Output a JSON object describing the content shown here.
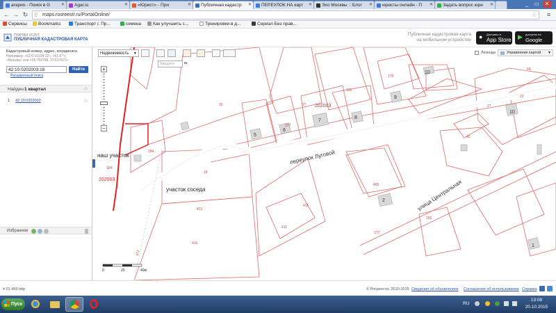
{
  "browser": {
    "tabs": [
      {
        "label": "агарио - Поиск в G",
        "fav": "#3b7be0"
      },
      {
        "label": "Agar.io",
        "fav": "#a43ad9"
      },
      {
        "label": "«Юрист» - При",
        "fav": "#e05a2a"
      },
      {
        "label": "Публичная кадастр",
        "fav": "#3a6fc9",
        "active": true
      },
      {
        "label": "ПЕРЕУЛОК НА карт",
        "fav": "#3b7be0"
      },
      {
        "label": "Эхо Москвы :: Блог",
        "fav": "#333333"
      },
      {
        "label": "юристы онлайн - П",
        "fav": "#3b7be0"
      },
      {
        "label": "Задать вопрос юри",
        "fav": "#2bb24c"
      }
    ],
    "url": "maps.rosreestr.ru/PortalOnline/",
    "bookmarks": [
      {
        "label": "Сервисы",
        "color": "#e04a2f"
      },
      {
        "label": "Bookmarks",
        "color": "#f4c430"
      },
      {
        "label": "Транспорт г. Пр...",
        "color": "#2a7be4"
      },
      {
        "label": "семена",
        "color": "#2bb24c"
      },
      {
        "label": "Как улучшить с...",
        "color": "#999999"
      },
      {
        "label": "Тренировки в д...",
        "color": "#ffffff"
      },
      {
        "label": "Сериал Без прав...",
        "color": "#3a3a3a"
      }
    ]
  },
  "portal": {
    "logo_line1": "ПОРТАЛ УСЛУГ",
    "logo_line2": "ПУБЛИЧНАЯ КАДАСТРОВАЯ КАРТА",
    "mobile_line1": "Публичная кадастровая карта",
    "mobile_line2": "на мобильном устройстве",
    "appstore_small": "Доступно в",
    "appstore_big": "App Store",
    "gplay_small": "доступно на",
    "gplay_big": "Google play"
  },
  "search": {
    "hint_title": "Кадастровый номер, адрес, координата",
    "hint_example1": "Например: «61:6:10104:12», «61:6:*»,",
    "hint_example2": "«Москва» или «55.755768, 37.617671»",
    "value": "42:10:0202003:18",
    "button": "Найти",
    "advanced": "Расширенный поиск",
    "found_prefix": "Найден",
    "found_bold": "1 квартал",
    "result_num": "1.",
    "result_link": "42:10:0202003",
    "favorites": "Избранное"
  },
  "map_toolbar": {
    "layer_select": "Недвижимость",
    "scale_input_placeholder": "Введите",
    "scale_unit": "м.",
    "legend": "Легенда",
    "map_control": "Управление картой"
  },
  "map_labels": {
    "quarter_top": "202003",
    "quarter_left": "202003",
    "our_plot": "наш участок",
    "neighbor_plot": "участок соседа",
    "lane": "переулок Луговой",
    "street": "улица Центральная",
    "parcels": [
      "19",
      "27",
      "161",
      "175",
      "44",
      "22",
      "18",
      "184",
      "184",
      "413",
      "413",
      "411",
      "411",
      "406",
      "177",
      "165",
      "42",
      "377",
      "5",
      "6",
      "7",
      "8",
      "9",
      "10",
      "10",
      "2",
      "1",
      "472"
    ],
    "scale_labels": [
      "0",
      "20",
      "40м"
    ]
  },
  "status": {
    "coords": "4 01.499 http",
    "copyright": "© Росреестр, 2010-2015",
    "links": [
      "Сведения об обновлениях",
      "Соглашение об использовании",
      "Справка"
    ]
  },
  "taskbar": {
    "start": "Пуск",
    "lang": "RU",
    "time": "13:08",
    "date": "20.10.2015"
  }
}
